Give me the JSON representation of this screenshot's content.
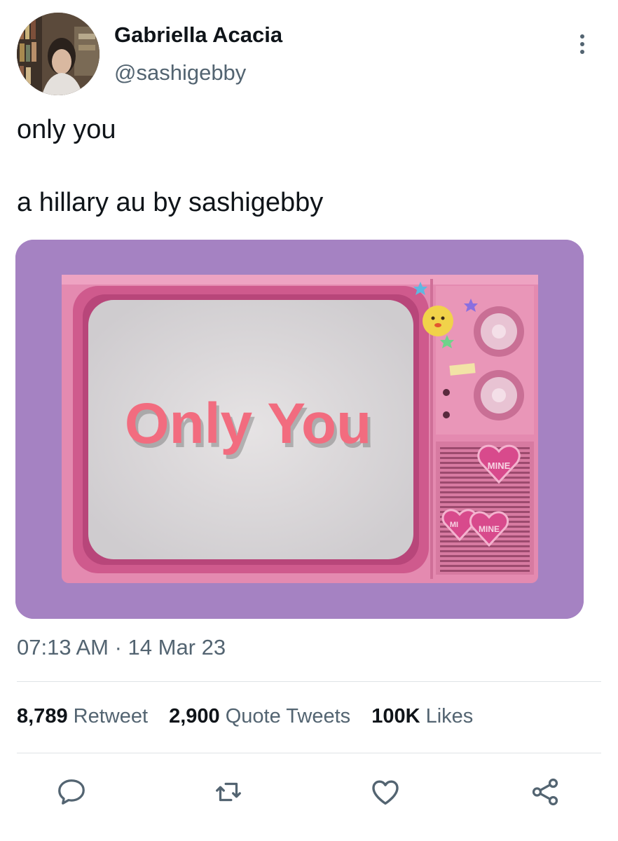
{
  "tweet": {
    "author": {
      "display_name": "Gabriella Acacia",
      "handle": "@sashigebby"
    },
    "text_lines": [
      "only you",
      "a hillary au by sashigebby"
    ],
    "media": {
      "screen_text": "Only You",
      "sticker_text": "MINE",
      "sticker_text_partial": "MI"
    },
    "timestamp": "07:13 AM · 14 Mar 23",
    "stats": {
      "retweets": {
        "count": "8,789",
        "label": "Retweet"
      },
      "quotes": {
        "count": "2,900",
        "label": "Quote Tweets"
      },
      "likes": {
        "count": "100K",
        "label": "Likes"
      }
    },
    "actions": [
      "reply-icon",
      "retweet-icon",
      "like-icon",
      "share-icon"
    ],
    "colors": {
      "text": "#0f1419",
      "secondary": "#536471",
      "background": "#ffffff",
      "divider": "#dfe3e6"
    }
  }
}
